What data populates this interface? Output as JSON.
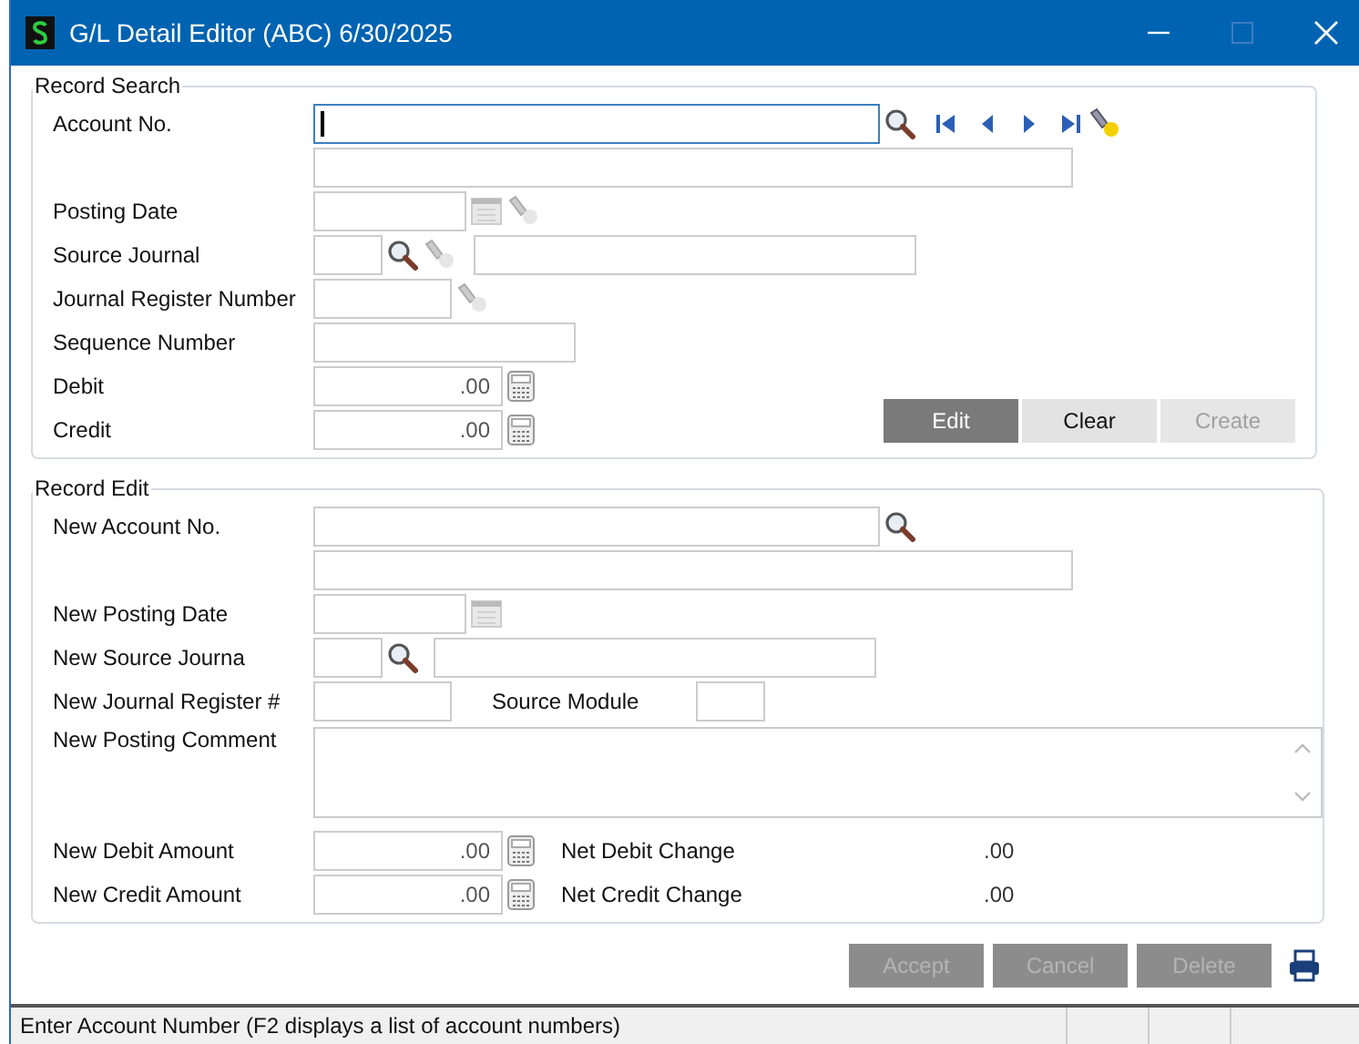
{
  "window": {
    "title": "G/L Detail Editor (ABC) 6/30/2025"
  },
  "record_search": {
    "title": "Record Search",
    "account_no": {
      "label": "Account No.",
      "focused": true
    },
    "posting_date": {
      "label": "Posting Date"
    },
    "source_journal": {
      "label": "Source Journal"
    },
    "journal_register_number": {
      "label": "Journal Register Number"
    },
    "sequence_number": {
      "label": "Sequence Number"
    },
    "debit": {
      "label": "Debit",
      "value": ".00"
    },
    "credit": {
      "label": "Credit",
      "value": ".00"
    },
    "buttons": [
      {
        "label": "Edit",
        "default": true,
        "disabled": false
      },
      {
        "label": "Clear",
        "default": false,
        "disabled": false
      },
      {
        "label": "Create",
        "default": false,
        "disabled": true
      }
    ]
  },
  "record_edit": {
    "title": "Record Edit",
    "new_account_no": {
      "label": "New Account No."
    },
    "new_posting_date": {
      "label": "New Posting Date"
    },
    "new_source_journal": {
      "label": "New Source Journa"
    },
    "new_journal_register": {
      "label": "New Journal Register #"
    },
    "source_module": {
      "label": "Source Module"
    },
    "new_posting_comment": {
      "label": "New Posting Comment"
    },
    "new_debit_amount": {
      "label": "New Debit Amount",
      "value": ".00"
    },
    "new_credit_amount": {
      "label": "New Credit Amount",
      "value": ".00"
    },
    "net_debit_change": {
      "label": "Net Debit Change",
      "value": ".00"
    },
    "net_credit_change": {
      "label": "Net Credit Change",
      "value": ".00"
    }
  },
  "footer_buttons": [
    {
      "label": "Accept",
      "disabled": true
    },
    {
      "label": "Cancel",
      "disabled": true
    },
    {
      "label": "Delete",
      "disabled": true
    }
  ],
  "status_bar": {
    "message": "Enter Account Number (F2 displays a list of account numbers)"
  }
}
